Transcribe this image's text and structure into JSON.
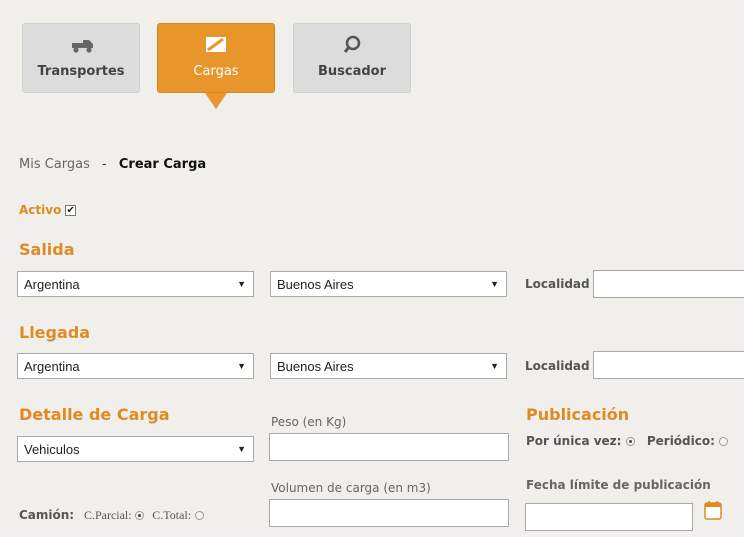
{
  "nav": {
    "tabs": [
      {
        "label": "Transportes",
        "icon": "truck-icon"
      },
      {
        "label": "Cargas",
        "icon": "cargo-icon",
        "active": true
      },
      {
        "label": "Buscador",
        "icon": "search-icon"
      }
    ]
  },
  "breadcrumb": {
    "parent": "Mis Cargas",
    "separator": "-",
    "current": "Crear Carga"
  },
  "activo": {
    "label": "Activo",
    "checked": true
  },
  "salida": {
    "title": "Salida",
    "country": "Argentina",
    "province": "Buenos Aires",
    "locality_label": "Localidad"
  },
  "llegada": {
    "title": "Llegada",
    "country": "Argentina",
    "province": "Buenos Aires",
    "locality_label": "Localidad"
  },
  "detalle": {
    "title": "Detalle de Carga",
    "type": "Vehiculos",
    "peso_label": "Peso (en Kg)",
    "volumen_label": "Volumen de carga (en m3)",
    "camion_label": "Camión:",
    "parcial_label": "C.Parcial:",
    "total_label": "C.Total:"
  },
  "publicacion": {
    "title": "Publicación",
    "unica_label": "Por única vez:",
    "periodico_label": "Periódico:",
    "fecha_label": "Fecha límite de publicación"
  },
  "colors": {
    "accent": "#e8962b",
    "tile": "#dcdcdc",
    "background": "#f1efec"
  }
}
